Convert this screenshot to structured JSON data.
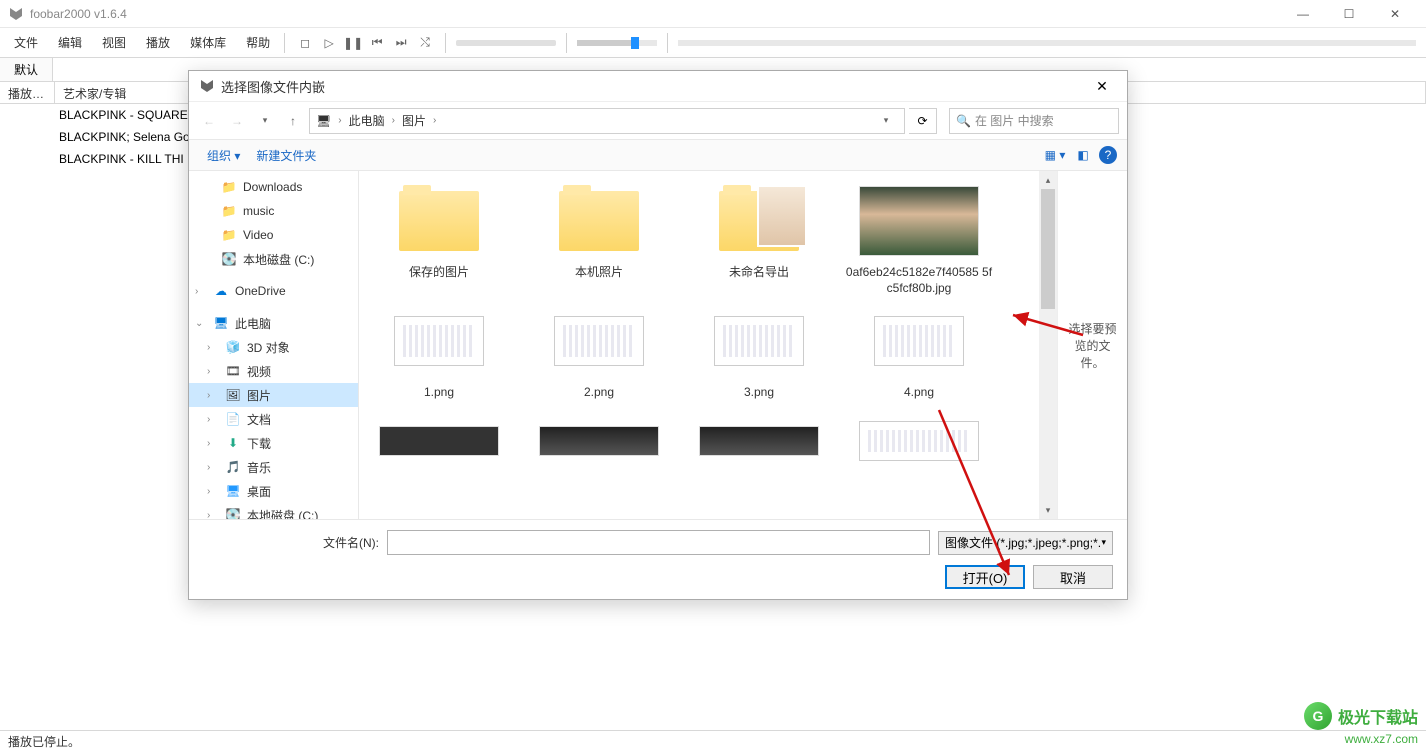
{
  "app": {
    "title": "foobar2000 v1.6.4"
  },
  "menu": {
    "items": [
      "文件",
      "编辑",
      "视图",
      "播放",
      "媒体库",
      "帮助"
    ]
  },
  "tab": {
    "default": "默认"
  },
  "columns": {
    "c1": "播放…",
    "c2": "艺术家/专辑"
  },
  "playlist": {
    "rows": [
      "BLACKPINK - SQUARE",
      "BLACKPINK; Selena Go",
      "BLACKPINK - KILL THI"
    ]
  },
  "status": {
    "text": "播放已停止。"
  },
  "dialog": {
    "title": "选择图像文件内嵌",
    "breadcrumb": {
      "root_icon": "pc",
      "parts": [
        "此电脑",
        "图片"
      ]
    },
    "search_placeholder": "在 图片 中搜索",
    "toolbar": {
      "organize": "组织",
      "newfolder": "新建文件夹"
    },
    "tree": [
      {
        "label": "Downloads",
        "icon": "folder",
        "lvl": 1
      },
      {
        "label": "music",
        "icon": "folder",
        "lvl": 1
      },
      {
        "label": "Video",
        "icon": "folder",
        "lvl": 1
      },
      {
        "label": "本地磁盘 (C:)",
        "icon": "disk",
        "lvl": 1
      },
      {
        "label": "OneDrive",
        "icon": "cloud",
        "lvl": 0,
        "expander": ">"
      },
      {
        "label": "此电脑",
        "icon": "pc",
        "lvl": 0,
        "expander": "v"
      },
      {
        "label": "3D 对象",
        "icon": "3d",
        "lvl": 1,
        "expander": ">"
      },
      {
        "label": "视频",
        "icon": "video",
        "lvl": 1,
        "expander": ">"
      },
      {
        "label": "图片",
        "icon": "pic",
        "lvl": 1,
        "expander": ">",
        "selected": true
      },
      {
        "label": "文档",
        "icon": "doc",
        "lvl": 1,
        "expander": ">"
      },
      {
        "label": "下载",
        "icon": "dl",
        "lvl": 1,
        "expander": ">"
      },
      {
        "label": "音乐",
        "icon": "music",
        "lvl": 1,
        "expander": ">"
      },
      {
        "label": "桌面",
        "icon": "desk",
        "lvl": 1,
        "expander": ">"
      },
      {
        "label": "本地磁盘 (C:)",
        "icon": "disk",
        "lvl": 1,
        "expander": ">"
      }
    ],
    "files": [
      {
        "name": "保存的图片",
        "type": "folder"
      },
      {
        "name": "本机照片",
        "type": "folder"
      },
      {
        "name": "未命名导出",
        "type": "folder-photo"
      },
      {
        "name": "0af6eb24c5182e7f40585 5fc5fcf80b.jpg",
        "type": "image-face"
      },
      {
        "name": "1.png",
        "type": "screenshot"
      },
      {
        "name": "2.png",
        "type": "screenshot"
      },
      {
        "name": "3.png",
        "type": "screenshot"
      },
      {
        "name": "4.png",
        "type": "screenshot"
      },
      {
        "name": "",
        "type": "dark"
      },
      {
        "name": "",
        "type": "dark2"
      },
      {
        "name": "",
        "type": "dark2"
      },
      {
        "name": "",
        "type": "screenshot"
      }
    ],
    "preview_hint": "选择要预览的文件。",
    "filename_label": "文件名(N):",
    "filter": "图像文件 (*.jpg;*.jpeg;*.png;*.",
    "open_btn": "打开(O)",
    "cancel_btn": "取消"
  },
  "annotations": {
    "text1_l1": "选择要预览",
    "text1_l2": "的文件。"
  },
  "watermark": {
    "name": "极光下载站",
    "url": "www.xz7.com"
  }
}
